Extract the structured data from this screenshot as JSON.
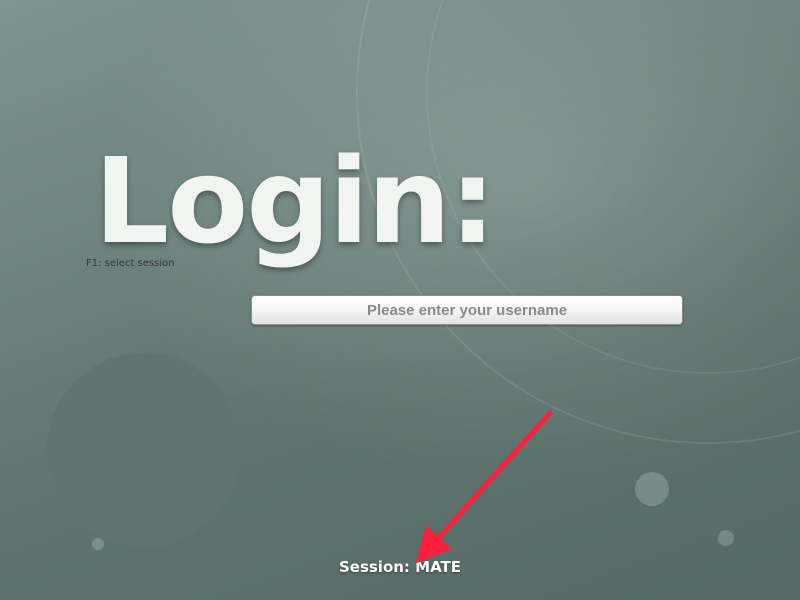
{
  "title": "Login:",
  "hint": "F1: select session",
  "username": {
    "value": "",
    "placeholder": "Please enter your username"
  },
  "session": {
    "label": "Session: ",
    "value": "MATE"
  },
  "annotation": {
    "arrow_color": "#ff1e3c"
  }
}
